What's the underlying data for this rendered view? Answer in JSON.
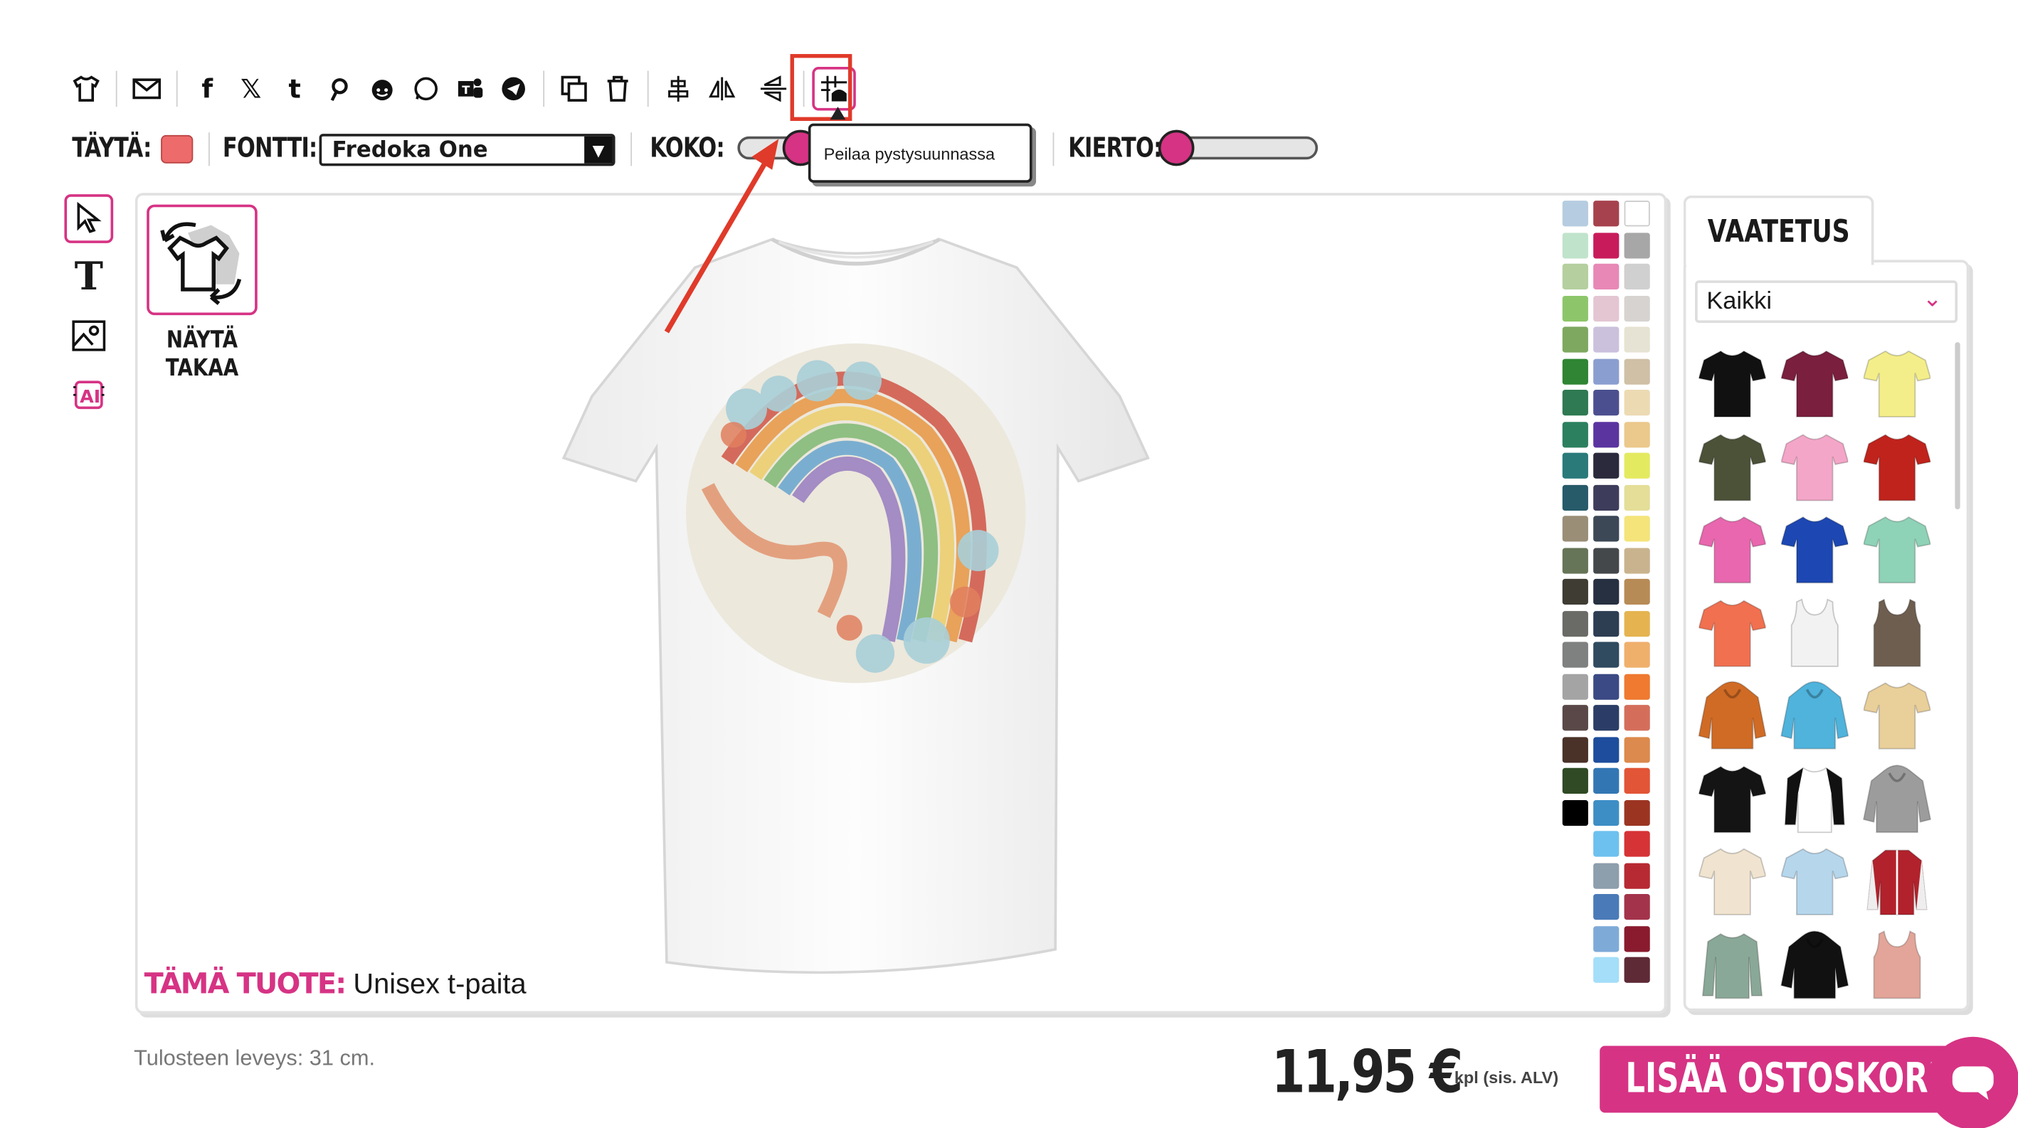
{
  "toolbar": {
    "tooltip": "Peilaa pystysuunnassa"
  },
  "options": {
    "fill_label": "TÄYTÄ:",
    "fill_color": "#ee6b6b",
    "font_label": "FONTTI:",
    "font_value": "Fredoka One",
    "size_label": "KOKO:",
    "rotation_label": "KIERTO:"
  },
  "design": {
    "show_back_label": "NÄYTÄ TAKAA",
    "product_prefix": "TÄMÄ TUOTE:",
    "product_name": "Unisex t-paita"
  },
  "colors": [
    "#b6cce0",
    "#a6424d",
    "#ffffff",
    "#c0e3cb",
    "#c81b5b",
    "#a7a7a7",
    "#b5cf9e",
    "#e788b6",
    "#d0d0d0",
    "#8dc66a",
    "#e3c6d2",
    "#d6d3d0",
    "#7ea860",
    "#cbc1dd",
    "#e6e3d4",
    "#2f8533",
    "#8b9ed0",
    "#cfc0a6",
    "#2f7a52",
    "#4c4f8f",
    "#ecdab3",
    "#2c8060",
    "#5b34a0",
    "#ebc88b",
    "#2a7a7a",
    "#2a2a3c",
    "#e4ea60",
    "#275b6a",
    "#3d3c5a",
    "#e4de98",
    "#9a8e77",
    "#3c4855",
    "#f4e47a",
    "#667557",
    "#45484b",
    "#c9b38e",
    "#3e3c33",
    "#263040",
    "#b78b55",
    "#6a6b66",
    "#2d3d52",
    "#e5b450",
    "#7f8080",
    "#304a5f",
    "#efb06c",
    "#a4a4a4",
    "#3b4a84",
    "#ef7a30",
    "#5a4848",
    "#2b3d66",
    "#d46e5b",
    "#4a3228",
    "#1d4d9c",
    "#dc8a4d",
    "#2f4a24",
    "#3277b4",
    "#e25536",
    "#000000",
    "#3d8ec5",
    "#9b3522",
    "",
    "#6dc1ee",
    "#d63336",
    "",
    "#8d9eac",
    "#b72a33",
    "",
    "#4a7ab8",
    "#a3334a",
    "",
    "#7eaad8",
    "#8a1b2e",
    "",
    "#a4def8",
    "#5e2a36"
  ],
  "catalog": {
    "tab": "VAATETUS",
    "category": "Kaikki",
    "items": [
      {
        "kind": "tee",
        "color": "#111111"
      },
      {
        "kind": "tee",
        "color": "#7a1f3d"
      },
      {
        "kind": "tee",
        "color": "#f4ee8a"
      },
      {
        "kind": "tee",
        "color": "#4b5238"
      },
      {
        "kind": "tee",
        "color": "#f4a6c8"
      },
      {
        "kind": "tee",
        "color": "#c0231c"
      },
      {
        "kind": "tee",
        "color": "#e867ae"
      },
      {
        "kind": "tee",
        "color": "#1d48b3"
      },
      {
        "kind": "tee",
        "color": "#8ed2b7"
      },
      {
        "kind": "tee",
        "color": "#f07050"
      },
      {
        "kind": "tank",
        "color": "#f2f2f2"
      },
      {
        "kind": "tank",
        "color": "#6e5e50"
      },
      {
        "kind": "hoodie",
        "color": "#d06b25"
      },
      {
        "kind": "hoodie",
        "color": "#4fb3dc"
      },
      {
        "kind": "tee",
        "color": "#e9cf9a"
      },
      {
        "kind": "tee",
        "color": "#141414"
      },
      {
        "kind": "raglan",
        "color": "#ffffff"
      },
      {
        "kind": "hoodie",
        "color": "#9c9c9c"
      },
      {
        "kind": "tee",
        "color": "#f0e4d0"
      },
      {
        "kind": "tee",
        "color": "#b6d6ec"
      },
      {
        "kind": "jacket",
        "color": "#b2222c"
      },
      {
        "kind": "long",
        "color": "#8aa897"
      },
      {
        "kind": "hoodie",
        "color": "#111111"
      },
      {
        "kind": "tank",
        "color": "#e3a599"
      }
    ]
  },
  "footer": {
    "print_width": "Tulosteen leveys: 31 cm.",
    "price": "11,95 €",
    "vat": "kpl (sis. ALV)",
    "cart_label": "LISÄÄ OSTOSKORIIN"
  }
}
